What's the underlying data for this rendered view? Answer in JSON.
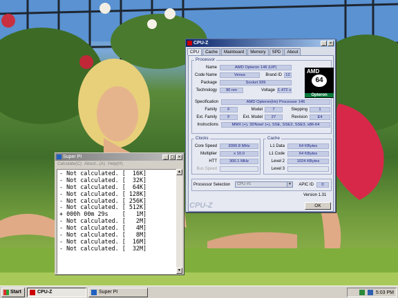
{
  "cpuz": {
    "title": "CPU-Z",
    "tabs": [
      "CPU",
      "Cache",
      "Mainboard",
      "Memory",
      "SPD",
      "About"
    ],
    "processor_group": "Processor",
    "name_label": "Name",
    "name": "AMD Opteron 146 (UP)",
    "code_name_label": "Code Name",
    "code_name": "Venus",
    "brand_id_label": "Brand ID",
    "brand_id": "12",
    "package_label": "Package",
    "package": "Socket 939",
    "technology_label": "Technology",
    "technology": "90 nm",
    "voltage_label": "Voltage",
    "voltage": "1.472 v",
    "specification_label": "Specification",
    "specification": "AMD Opteron(tm) Processor 146",
    "family_label": "Family",
    "family": "F",
    "model_label": "Model",
    "model": "7",
    "stepping_label": "Stepping",
    "stepping": "1",
    "ext_family_label": "Ext. Family",
    "ext_family": "F",
    "ext_model_label": "Ext. Model",
    "ext_model": "27",
    "revision_label": "Revision",
    "revision": "E4",
    "instructions_label": "Instructions",
    "instructions": "MMX (+), 3DNow! (+), SSE, SSE2, SSE3, x86-64",
    "logo": {
      "brand": "AMD",
      "mark": "64",
      "line": "Opteron"
    },
    "clocks_group": "Clocks",
    "core_speed_label": "Core Speed",
    "core_speed": "3000.8 MHz",
    "multiplier_label": "Multiplier",
    "multiplier": "x 10.0",
    "htt_label": "HTT",
    "htt": "300.1 MHz",
    "bus_speed_label": "Bus Speed",
    "bus_speed": "",
    "cache_group": "Cache",
    "l1_data_label": "L1 Data",
    "l1_data": "64 KBytes",
    "l1_code_label": "L1 Code",
    "l1_code": "64 KBytes",
    "level2_label": "Level 2",
    "level2": "1024 KBytes",
    "level3_label": "Level 3",
    "level3": "",
    "processor_selection_label": "Processor Selection",
    "processor_selection": "CPU #1",
    "apic_id_label": "APIC ID",
    "apic_id": "0",
    "version": "Version 1.31",
    "brand": "CPU-Z",
    "ok_label": "OK"
  },
  "superpi": {
    "title": "Super PI",
    "menu": [
      "Calculate(C)",
      "About...(A)",
      "Help(H)"
    ],
    "rows": [
      "- Not calculated. [  16K]",
      "- Not calculated. [  32K]",
      "- Not calculated. [  64K]",
      "- Not calculated. [ 128K]",
      "- Not calculated. [ 256K]",
      "- Not calculated. [ 512K]",
      "+ 000h 00m 29s    [   1M]",
      "- Not calculated. [   2M]",
      "- Not calculated. [   4M]",
      "- Not calculated. [   8M]",
      "- Not calculated. [  16M]",
      "- Not calculated. [  32M]"
    ]
  },
  "taskbar": {
    "start_label": "Start",
    "tasks": [
      "CPU-Z",
      "Super PI"
    ],
    "clock": "5:03 PM"
  }
}
